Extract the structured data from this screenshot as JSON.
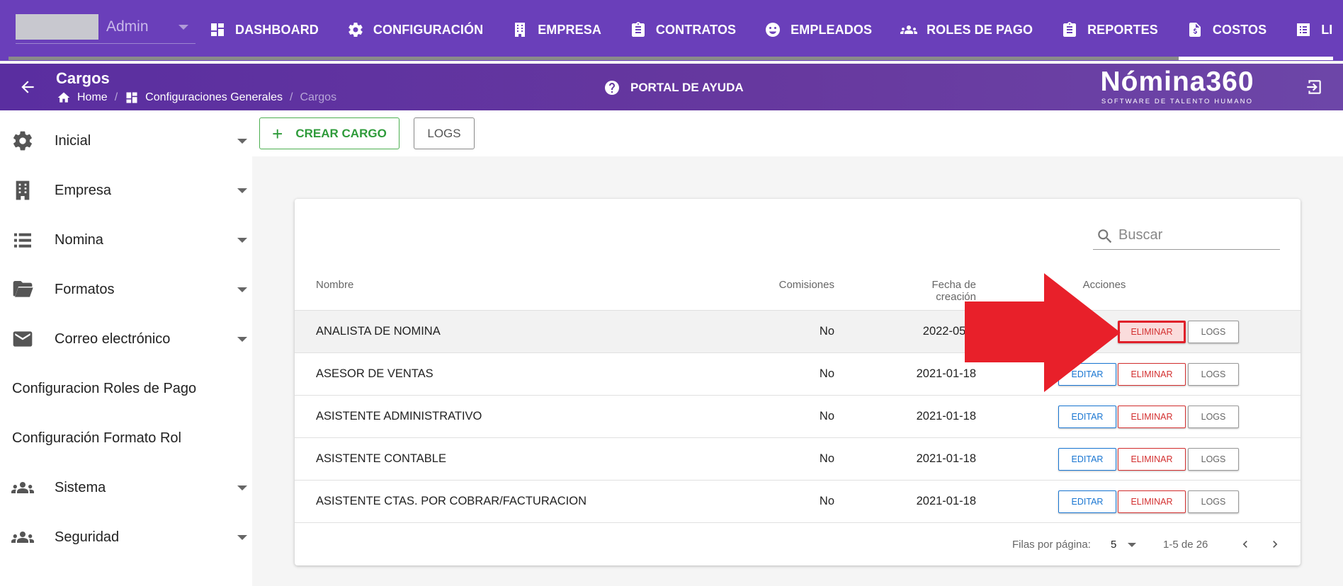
{
  "company": {
    "name": "Admin"
  },
  "topnav": [
    {
      "label": "DASHBOARD",
      "icon": "dashboard-icon"
    },
    {
      "label": "CONFIGURACIÓN",
      "icon": "gear-icon"
    },
    {
      "label": "EMPRESA",
      "icon": "building-icon"
    },
    {
      "label": "CONTRATOS",
      "icon": "clipboard-icon"
    },
    {
      "label": "EMPLEADOS",
      "icon": "face-icon"
    },
    {
      "label": "ROLES DE PAGO",
      "icon": "group-icon"
    },
    {
      "label": "REPORTES",
      "icon": "clipboard-icon"
    },
    {
      "label": "COSTOS",
      "icon": "invoice-icon"
    },
    {
      "label": "LIQUIDACIONE",
      "icon": "list-icon"
    }
  ],
  "header": {
    "title": "Cargos",
    "breadcrumb": {
      "home": "Home",
      "parent": "Configuraciones Generales",
      "current": "Cargos",
      "sep": "/"
    },
    "help": "PORTAL DE AYUDA",
    "brand": {
      "name": "Nómina360",
      "tagline": "SOFTWARE DE TALENTO HUMANO"
    }
  },
  "sidebar": {
    "items": [
      {
        "label": "Inicial",
        "icon": "gear-icon",
        "expandable": true
      },
      {
        "label": "Empresa",
        "icon": "building-icon",
        "expandable": true
      },
      {
        "label": "Nomina",
        "icon": "list-icon",
        "expandable": true
      },
      {
        "label": "Formatos",
        "icon": "folder-open-icon",
        "expandable": true
      },
      {
        "label": "Correo electrónico",
        "icon": "mail-icon",
        "expandable": true
      },
      {
        "label": "Configuracion Roles de Pago",
        "icon": "",
        "expandable": false
      },
      {
        "label": "Configuración Formato Rol",
        "icon": "",
        "expandable": false
      },
      {
        "label": "Sistema",
        "icon": "group-icon",
        "expandable": true
      },
      {
        "label": "Seguridad",
        "icon": "group-icon",
        "expandable": true
      }
    ]
  },
  "toolbar": {
    "create_label": "CREAR CARGO",
    "logs_label": "LOGS"
  },
  "table": {
    "search_placeholder": "Buscar",
    "headers": {
      "name": "Nombre",
      "commissions": "Comisiones",
      "created": "Fecha de creación",
      "actions": "Acciones"
    },
    "action_labels": {
      "edit": "EDITAR",
      "delete": "ELIMINAR",
      "logs": "LOGS"
    },
    "rows": [
      {
        "name": "ANALISTA DE NOMINA",
        "commissions": "No",
        "created": "2022-05-1",
        "highlight": true
      },
      {
        "name": "ASESOR DE VENTAS",
        "commissions": "No",
        "created": "2021-01-18",
        "highlight": false
      },
      {
        "name": "ASISTENTE ADMINISTRATIVO",
        "commissions": "No",
        "created": "2021-01-18",
        "highlight": false
      },
      {
        "name": "ASISTENTE CONTABLE",
        "commissions": "No",
        "created": "2021-01-18",
        "highlight": false
      },
      {
        "name": "ASISTENTE CTAS. POR COBRAR/FACTURACION",
        "commissions": "No",
        "created": "2021-01-18",
        "highlight": false
      }
    ],
    "footer": {
      "rows_label": "Filas por página:",
      "rows_per_page": "5",
      "range": "1-5 de 26"
    }
  },
  "colors": {
    "primary": "#6a3fba",
    "create": "#2e9b3a",
    "edit": "#1976d2",
    "delete": "#d32f2f",
    "annotation": "#e0202a"
  }
}
